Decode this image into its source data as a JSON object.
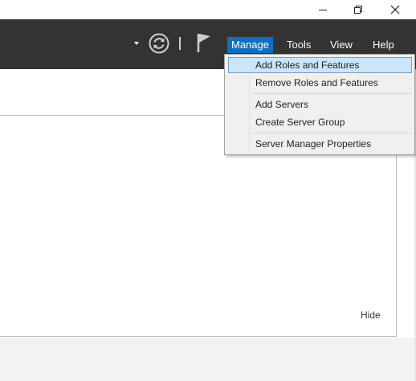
{
  "window_controls": {
    "minimize_icon": "minimize-icon",
    "restore_icon": "restore-icon",
    "close_icon": "close-icon"
  },
  "toolbar": {
    "icons": [
      "dropdown-arrow-icon",
      "refresh-icon",
      "notification-flag-icon"
    ],
    "menus": [
      "Manage",
      "Tools",
      "View",
      "Help"
    ],
    "active_menu": "Manage",
    "active_color": "#0e6fc2",
    "background_color": "#333333"
  },
  "manage_menu": {
    "items": [
      "Add Roles and Features",
      "Remove Roles and Features",
      "Add Servers",
      "Create Server Group",
      "Server Manager Properties"
    ],
    "highlighted": "Add Roles and Features",
    "highlight_color": "#cce4f7"
  },
  "panel": {
    "hide_label": "Hide"
  }
}
